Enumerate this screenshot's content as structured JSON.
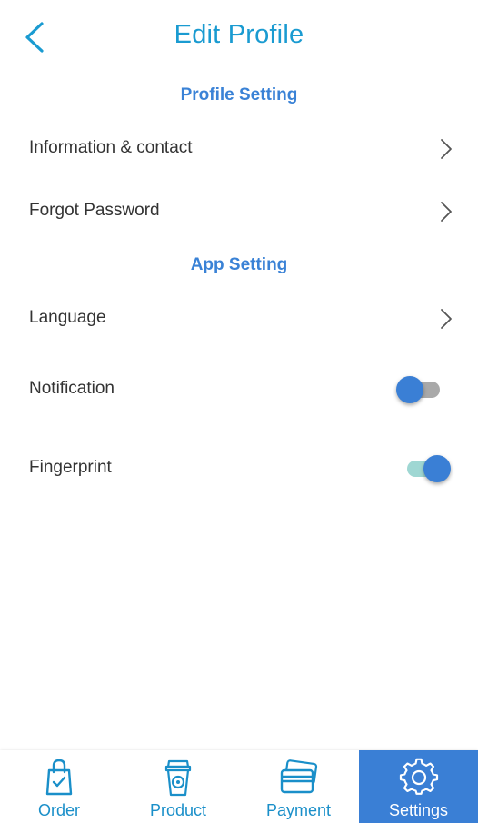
{
  "header": {
    "title": "Edit Profile",
    "back_icon": "chevron-left-icon"
  },
  "colors": {
    "title": "#1a9bd1",
    "section": "#3a82d6",
    "accent": "#3a7fd5",
    "toggle_on_track": "#9fd7d3",
    "toggle_off_track": "#a9a9a9"
  },
  "sections": [
    {
      "title": "Profile Setting",
      "items": [
        {
          "label": "Information & contact",
          "control": "chevron-right-icon"
        },
        {
          "label": "Forgot Password",
          "control": "chevron-right-icon"
        }
      ]
    },
    {
      "title": "App Setting",
      "items": [
        {
          "label": "Language",
          "control": "chevron-right-icon"
        },
        {
          "label": "Notification",
          "control": "toggle",
          "checked": false
        },
        {
          "label": "Fingerprint",
          "control": "toggle",
          "checked": true
        }
      ]
    }
  ],
  "bottom_nav": {
    "items": [
      {
        "label": "Order",
        "icon": "shopping-bag-icon",
        "active": false
      },
      {
        "label": "Product",
        "icon": "coffee-cup-icon",
        "active": false
      },
      {
        "label": "Payment",
        "icon": "credit-card-icon",
        "active": false
      },
      {
        "label": "Settings",
        "icon": "gear-icon",
        "active": true
      }
    ]
  }
}
